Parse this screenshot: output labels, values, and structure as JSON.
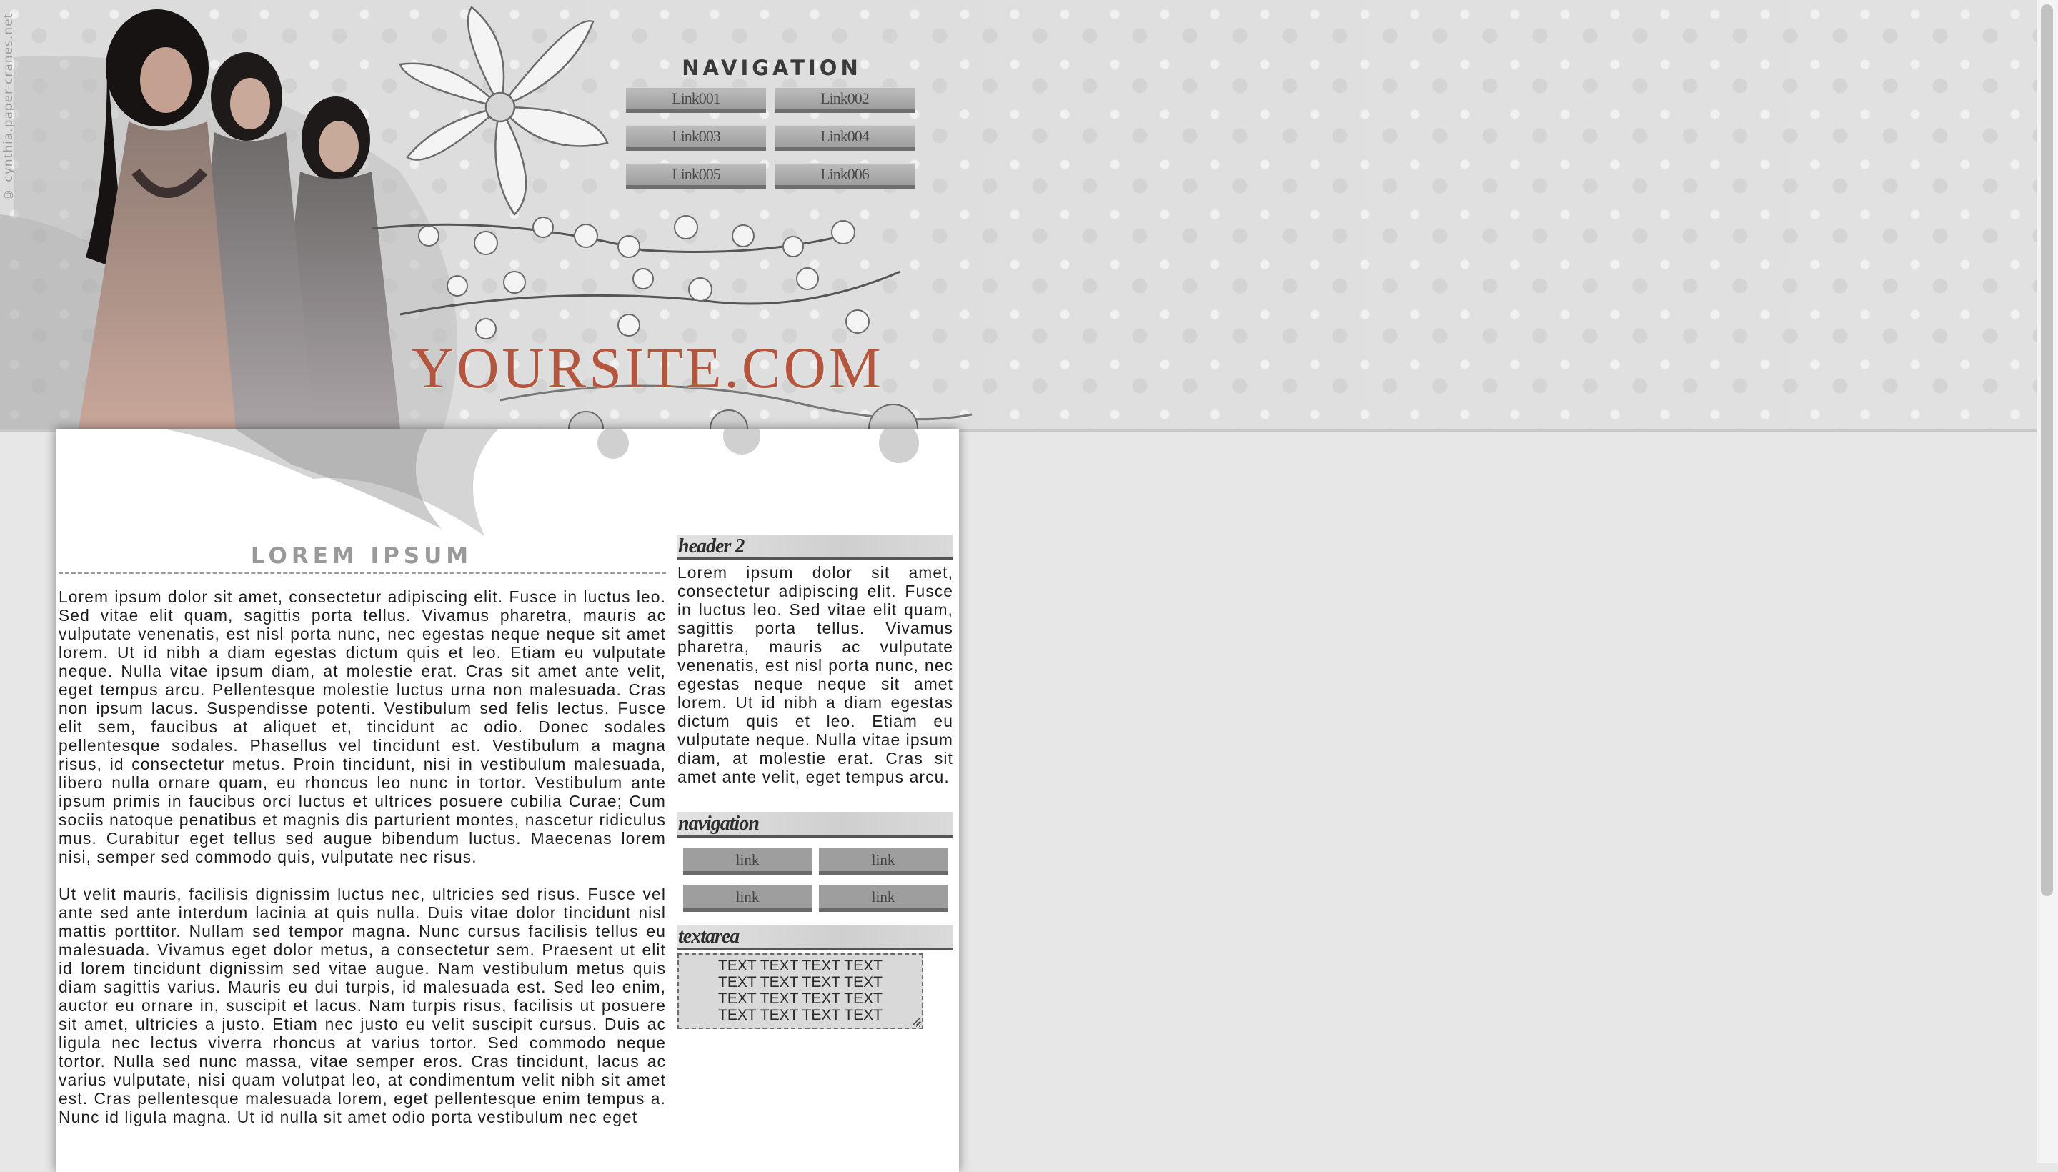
{
  "header": {
    "credit": "© cynthia.paper-cranes.net",
    "navigation_title": "NAVIGATION",
    "nav_links": [
      "Link001",
      "Link002",
      "Link003",
      "Link004",
      "Link005",
      "Link006"
    ],
    "site_name": "YOURSITE.COM",
    "site_name_color": "#b4553d"
  },
  "main": {
    "title": "LOREM IPSUM",
    "paragraphs": [
      "Lorem ipsum dolor sit amet, consectetur adipiscing elit. Fusce in luctus leo. Sed vitae elit quam, sagittis porta tellus. Vivamus pharetra, mauris ac vulputate venenatis, est nisl porta nunc, nec egestas neque neque sit amet lorem. Ut id nibh a diam egestas dictum quis et leo. Etiam eu vulputate neque. Nulla vitae ipsum diam, at molestie erat. Cras sit amet ante velit, eget tempus arcu. Pellentesque molestie luctus urna non malesuada. Cras non ipsum lacus. Suspendisse potenti. Vestibulum sed felis lectus. Fusce elit sem, faucibus at aliquet et, tincidunt ac odio. Donec sodales pellentesque sodales. Phasellus vel tincidunt est. Vestibulum a magna risus, id consectetur metus. Proin tincidunt, nisi in vestibulum malesuada, libero nulla ornare quam, eu rhoncus leo nunc in tortor. Vestibulum ante ipsum primis in faucibus orci luctus et ultrices posuere cubilia Curae; Cum sociis natoque penatibus et magnis dis parturient montes, nascetur ridiculus mus. Curabitur eget tellus sed augue bibendum luctus. Maecenas lorem nisi, semper sed commodo quis, vulputate nec risus.",
      "Ut velit mauris, facilisis dignissim luctus nec, ultricies sed risus. Fusce vel ante sed ante interdum lacinia at quis nulla. Duis vitae dolor tincidunt nisl mattis porttitor. Nullam sed tempor magna. Nunc cursus facilisis tellus eu malesuada. Vivamus eget dolor metus, a consectetur sem. Praesent ut elit id lorem tincidunt dignissim sed vitae augue. Nam vestibulum metus quis diam sagittis varius. Mauris eu dui turpis, id malesuada est. Sed leo enim, auctor eu ornare in, suscipit et lacus. Nam turpis risus, facilisis ut posuere sit amet, ultricies a justo. Etiam nec justo eu velit suscipit cursus. Duis ac ligula nec lectus viverra rhoncus at varius tortor. Sed commodo neque tortor. Nulla sed nunc massa, vitae semper eros. Cras tincidunt, lacus ac varius vulputate, nisi quam volutpat leo, at condimentum velit nibh sit amet est. Cras pellentesque malesuada lorem, eget pellentesque enim tempus a. Nunc id ligula magna. Ut id nulla sit amet odio porta vestibulum nec eget"
    ]
  },
  "sidebar": {
    "header2": "header 2",
    "header2_text": "Lorem ipsum dolor sit amet, consectetur adipiscing elit. Fusce in luctus leo. Sed vitae elit quam, sagittis porta tellus. Vivamus pharetra, mauris ac vulputate venenatis, est nisl porta nunc, nec egestas neque neque sit amet lorem. Ut id nibh a diam egestas dictum quis et leo. Etiam eu vulputate neque. Nulla vitae ipsum diam, at molestie erat. Cras sit amet ante velit, eget tempus arcu.",
    "navigation": "navigation",
    "links": [
      "link",
      "link",
      "link",
      "link"
    ],
    "textarea_heading": "textarea",
    "textarea_value": "TEXT TEXT TEXT TEXT TEXT TEXT TEXT TEXT TEXT TEXT TEXT TEXT TEXT TEXT TEXT TEXT"
  },
  "icons": {
    "photo": "people-photo-icon",
    "flowers": "flower-illustration-icon",
    "brush": "brush-stroke-icon",
    "grip": "resize-grip-icon"
  }
}
